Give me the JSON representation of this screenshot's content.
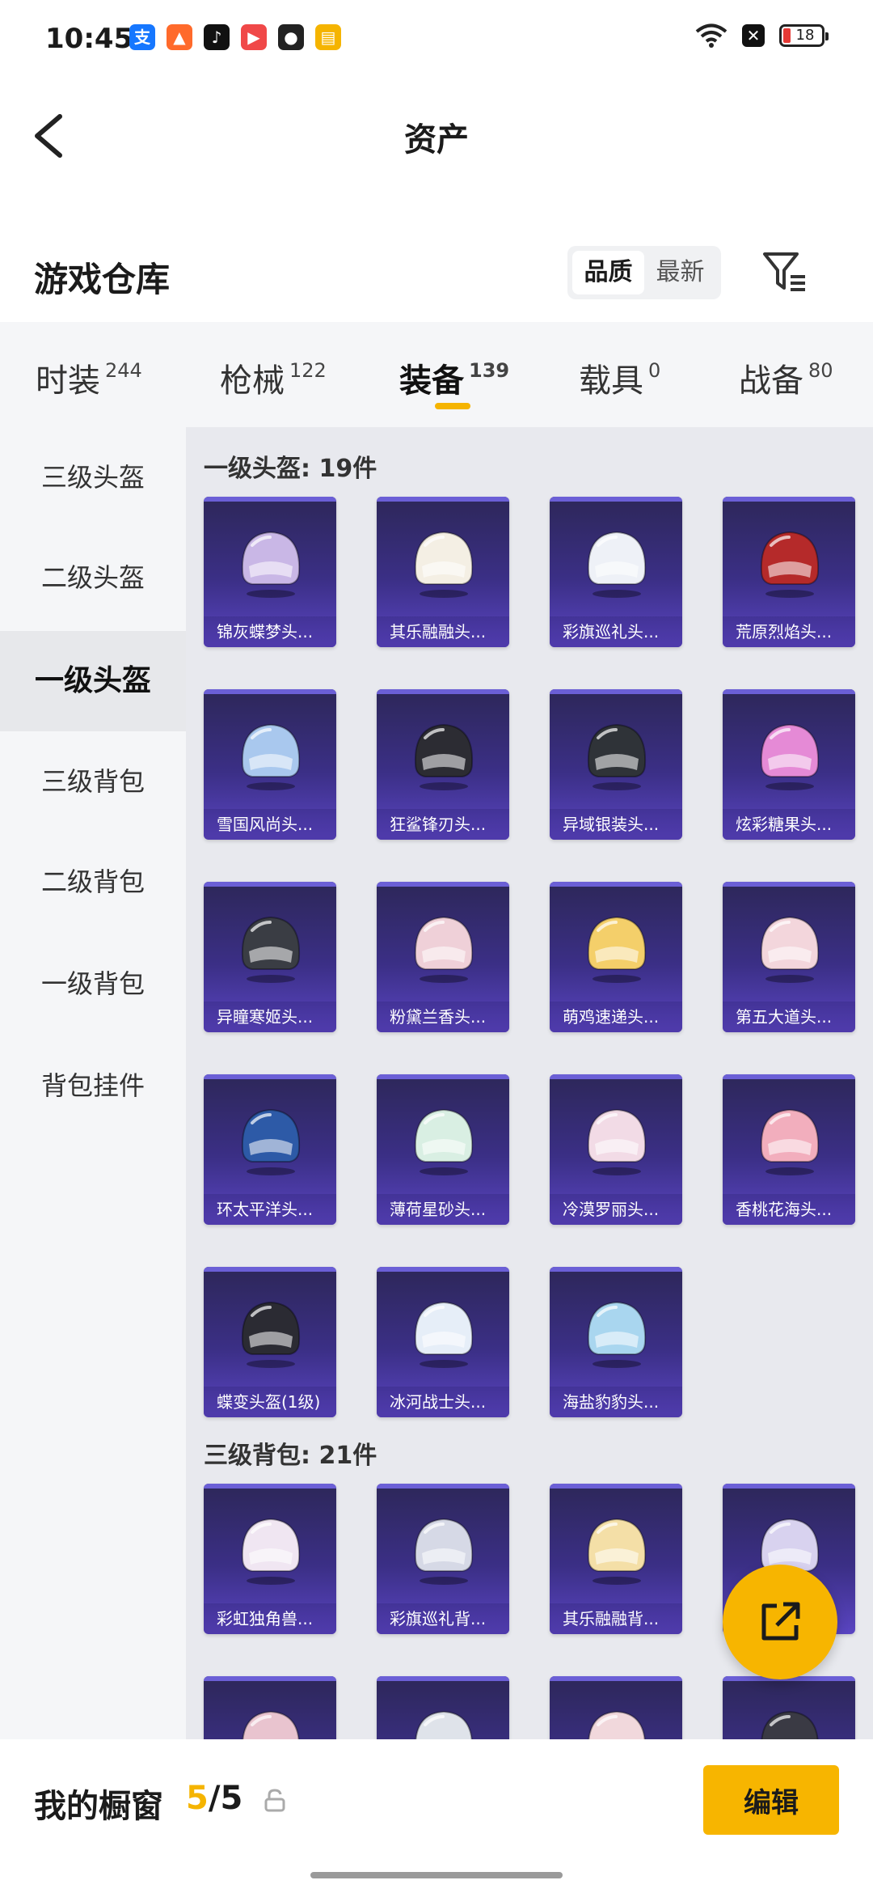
{
  "status_bar": {
    "time": "10:45",
    "battery": "18",
    "app_icons": [
      {
        "name": "alipay-icon",
        "glyph": "支",
        "color": "#1677ff"
      },
      {
        "name": "app-orange-icon",
        "glyph": "▲",
        "color": "#ff6a2b"
      },
      {
        "name": "tiktok-icon",
        "glyph": "♪",
        "color": "#111111"
      },
      {
        "name": "video-app-icon",
        "glyph": "▶",
        "color": "#f04848"
      },
      {
        "name": "wechat-icon",
        "glyph": "●",
        "color": "#222222"
      },
      {
        "name": "reader-app-icon",
        "glyph": "▤",
        "color": "#f5b400"
      }
    ]
  },
  "header": {
    "title": "资产"
  },
  "warehouse": {
    "title": "游戏仓库",
    "sort_options": [
      "品质",
      "最新"
    ]
  },
  "tabs": [
    {
      "label": "时装",
      "count": "244"
    },
    {
      "label": "枪械",
      "count": "122"
    },
    {
      "label": "装备",
      "count": "139"
    },
    {
      "label": "载具",
      "count": "0"
    },
    {
      "label": "战备",
      "count": "80"
    }
  ],
  "sidebar": [
    {
      "label": "三级头盔"
    },
    {
      "label": "二级头盔"
    },
    {
      "label": "一级头盔"
    },
    {
      "label": "三级背包"
    },
    {
      "label": "二级背包"
    },
    {
      "label": "一级背包"
    },
    {
      "label": "背包挂件"
    }
  ],
  "groups": [
    {
      "title": "一级头盔: 19件",
      "items": [
        {
          "name": "锦灰蝶梦头...",
          "color": "#c9b7e6"
        },
        {
          "name": "其乐融融头...",
          "color": "#f4efe4"
        },
        {
          "name": "彩旗巡礼头...",
          "color": "#eef1f7"
        },
        {
          "name": "荒原烈焰头...",
          "color": "#b52a2a"
        },
        {
          "name": "雪国风尚头...",
          "color": "#a9c8ee"
        },
        {
          "name": "狂鲨锋刃头...",
          "color": "#2c2c33"
        },
        {
          "name": "异域银装头...",
          "color": "#2f3338"
        },
        {
          "name": "炫彩糖果头...",
          "color": "#e58ad6"
        },
        {
          "name": "异瞳寒姬头...",
          "color": "#3a3d44"
        },
        {
          "name": "粉黛兰香头...",
          "color": "#efd0d8"
        },
        {
          "name": "萌鸡速递头...",
          "color": "#f4cf6a"
        },
        {
          "name": "第五大道头...",
          "color": "#f3d6dc"
        },
        {
          "name": "环太平洋头...",
          "color": "#2d5aa7"
        },
        {
          "name": "薄荷星砂头...",
          "color": "#d9efe3"
        },
        {
          "name": "冷漠罗丽头...",
          "color": "#f2dbe6"
        },
        {
          "name": "香桃花海头...",
          "color": "#f2aebd"
        },
        {
          "name": "蝶变头盔(1级)",
          "color": "#2b2b33"
        },
        {
          "name": "冰河战士头...",
          "color": "#e6eef8"
        },
        {
          "name": "海盐豹豹头...",
          "color": "#a9d6ef"
        }
      ]
    },
    {
      "title": "三级背包: 21件",
      "items": [
        {
          "name": "彩虹独角兽...",
          "color": "#f0e6f2"
        },
        {
          "name": "彩旗巡礼背...",
          "color": "#d6d9e6"
        },
        {
          "name": "其乐融融背...",
          "color": "#f4dfa7"
        },
        {
          "name": "",
          "color": "#d8d2ef"
        },
        {
          "name": "",
          "color": "#e9c4cf"
        },
        {
          "name": "",
          "color": "#dfe3ea"
        },
        {
          "name": "",
          "color": "#f1d8dc"
        },
        {
          "name": "",
          "color": "#3a3a44"
        }
      ]
    }
  ],
  "showcase": {
    "label": "我的橱窗",
    "current": "5",
    "total": "/5",
    "edit_label": "编辑"
  }
}
